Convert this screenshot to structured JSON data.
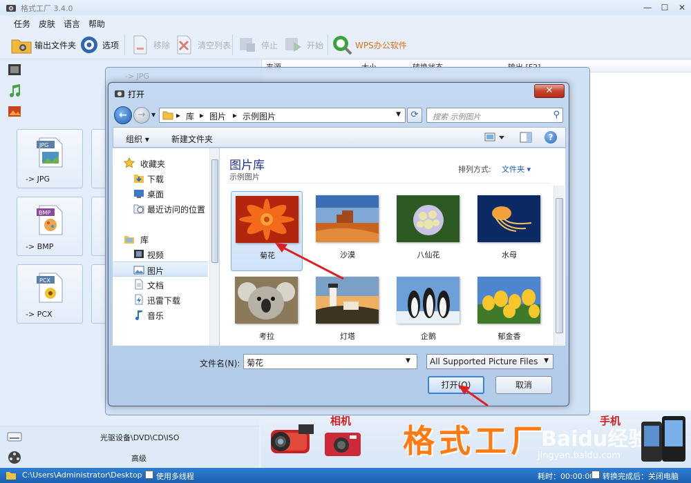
{
  "app": {
    "title": "格式工厂 3.4.0",
    "menu": [
      "任务",
      "皮肤",
      "语言",
      "帮助"
    ],
    "toolbar": {
      "output_folder": "输出文件夹",
      "options": "选项",
      "remove": "移除",
      "clear_list": "清空列表",
      "stop": "停止",
      "start": "开始",
      "wps": "WPS办公软件"
    },
    "tiles": [
      "-> JPG",
      "-> BMP",
      "-> PCX"
    ],
    "list_columns": [
      "来源",
      "大小",
      "转换状态",
      "输出 [F2]"
    ],
    "back_dialog_title": "-> JPG",
    "bottom": {
      "optical": "光驱设备\\DVD\\CD\\ISO",
      "advanced": "高级"
    },
    "banner": {
      "brand": "格式工厂",
      "camera": "相机",
      "phone": "手机",
      "watermark": "Baidu经验",
      "watermark_url": "jingyan.baidu.com"
    },
    "status": {
      "path": "C:\\Users\\Administrator\\Desktop",
      "multithread": "使用多线程",
      "elapsed": "耗时：00:00:00",
      "shutdown": "转换完成后：关闭电脑"
    }
  },
  "dialog": {
    "title": "打开",
    "address": [
      "库",
      "图片",
      "示例图片"
    ],
    "search_placeholder": "搜索 示例图片",
    "organize": "组织 ▾",
    "new_folder": "新建文件夹",
    "nav": {
      "favorites": "收藏夹",
      "downloads": "下载",
      "desktop": "桌面",
      "recent": "最近访问的位置",
      "libraries": "库",
      "videos": "视频",
      "pictures": "图片",
      "documents": "文档",
      "thunder": "迅雷下载",
      "music": "音乐"
    },
    "library_title": "图片库",
    "library_sub": "示例图片",
    "arrange_label": "排列方式:",
    "arrange_value": "文件夹 ▾",
    "files": [
      "菊花",
      "沙漠",
      "八仙花",
      "水母",
      "考拉",
      "灯塔",
      "企鹅",
      "郁金香"
    ],
    "filename_label": "文件名(N):",
    "filename_value": "菊花",
    "filter_value": "All Supported Picture Files",
    "open_button": "打开(O)",
    "cancel_button": "取消"
  },
  "colors": {
    "accent": "#3c7fd6",
    "brand_orange": "#ff7a10",
    "annotation_red": "#e02020",
    "status_blue": "#1b5fb0"
  }
}
